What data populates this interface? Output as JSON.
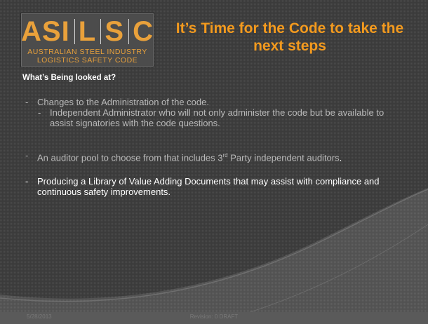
{
  "logo": {
    "letters": [
      "ASI",
      "L",
      "S",
      "C"
    ],
    "line1": "AUSTRALIAN STEEL INDUSTRY",
    "line2": "LOGISTICS SAFETY CODE"
  },
  "title": "It’s Time for the Code to take the next steps",
  "subheading": "What’s Being looked at?",
  "bullets": {
    "b1": "Changes to the Administration of the code.",
    "b1a": "Independent Administrator who will not only administer the code but be available to assist signatories with the code questions.",
    "b2_before": "An auditor pool to choose from that includes 3",
    "b2_sup": "rd",
    "b2_after": " Party independent auditors",
    "b2_period": ".",
    "b3": "Producing a Library of Value Adding Documents  that may assist with compliance and continuous safety improvements.",
    "dash": "-"
  },
  "footer": {
    "date": "5/28/2013",
    "revision": "Revision: 0 DRAFT"
  },
  "colors": {
    "title": "#f39a1e",
    "logo_orange": "#e9a13b",
    "background": "#333333",
    "footer": "#5a5a5a"
  }
}
